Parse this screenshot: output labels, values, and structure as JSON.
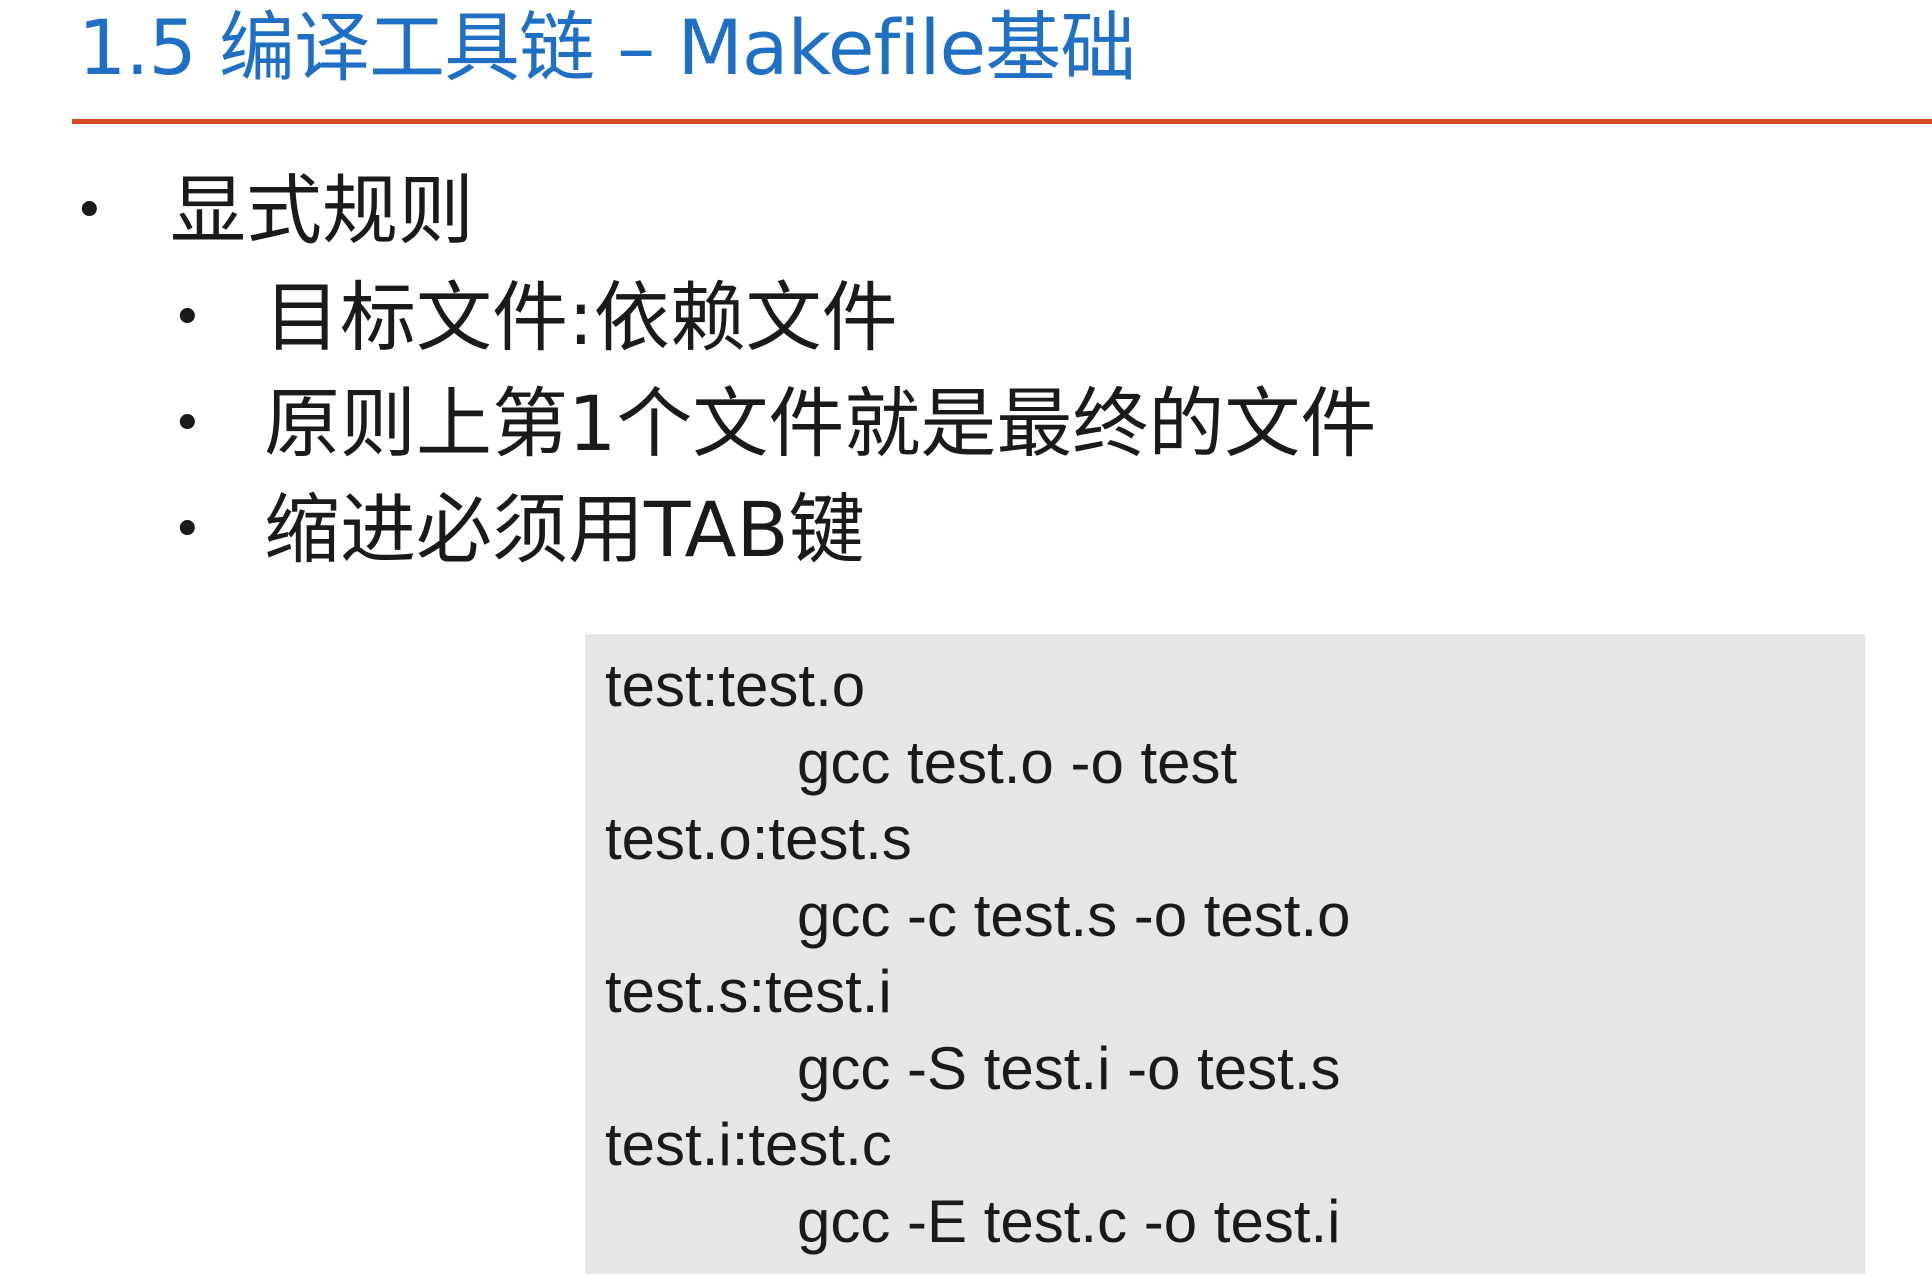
{
  "slide": {
    "title": "1.5 编译工具链 – Makefile基础",
    "colors": {
      "title": "#1f6fc4",
      "rule": "#d24a1e",
      "code_bg": "#e6e6e6"
    }
  },
  "bullets": {
    "marker": "•",
    "main": "显式规则",
    "sub": [
      "目标文件:依赖文件",
      "原则上第1个文件就是最终的文件",
      "缩进必须用TAB键"
    ]
  },
  "code": {
    "lines": [
      {
        "kind": "target",
        "text": "test:test.o"
      },
      {
        "kind": "cmd",
        "text": "gcc test.o -o test"
      },
      {
        "kind": "target",
        "text": "test.o:test.s"
      },
      {
        "kind": "cmd",
        "text": "gcc -c test.s -o test.o"
      },
      {
        "kind": "target",
        "text": "test.s:test.i"
      },
      {
        "kind": "cmd",
        "text": "gcc -S test.i -o test.s"
      },
      {
        "kind": "target",
        "text": "test.i:test.c"
      },
      {
        "kind": "cmd",
        "text": "gcc -E test.c -o test.i"
      }
    ]
  }
}
